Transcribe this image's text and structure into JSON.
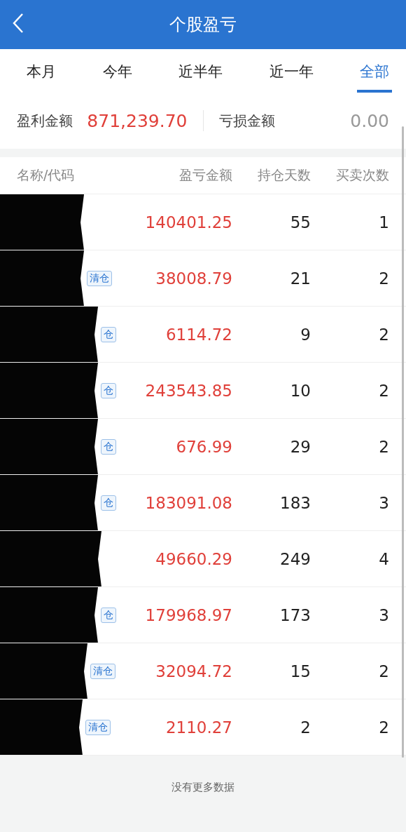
{
  "header": {
    "title": "个股盈亏"
  },
  "tabs": [
    {
      "label": "本月",
      "selected": false
    },
    {
      "label": "今年",
      "selected": false
    },
    {
      "label": "近半年",
      "selected": false
    },
    {
      "label": "近一年",
      "selected": false
    },
    {
      "label": "全部",
      "selected": true
    }
  ],
  "summary": {
    "profit_label": "盈利金额",
    "profit_value": "871,239.70",
    "loss_label": "亏损金额",
    "loss_value": "0.00"
  },
  "table": {
    "columns": [
      "名称/代码",
      "盈亏金额",
      "持仓天数",
      "买卖次数"
    ],
    "rows": [
      {
        "amount": "140401.25",
        "days": "55",
        "trades": "1"
      },
      {
        "tag": "清仓",
        "amount": "38008.79",
        "days": "21",
        "trades": "2"
      },
      {
        "tag": "仓",
        "amount": "6114.72",
        "days": "9",
        "trades": "2"
      },
      {
        "tag": "仓",
        "amount": "243543.85",
        "days": "10",
        "trades": "2"
      },
      {
        "tag": "仓",
        "amount": "676.99",
        "days": "29",
        "trades": "2"
      },
      {
        "tag": "仓",
        "amount": "183091.08",
        "days": "183",
        "trades": "3"
      },
      {
        "amount": "49660.29",
        "days": "249",
        "trades": "4"
      },
      {
        "tag": "仓",
        "amount": "179968.97",
        "days": "173",
        "trades": "3"
      },
      {
        "tag": "清仓",
        "amount": "32094.72",
        "days": "15",
        "trades": "2"
      },
      {
        "tag": "清仓",
        "amount": "2110.27",
        "days": "2",
        "trades": "2"
      }
    ]
  },
  "footer": "没有更多数据"
}
